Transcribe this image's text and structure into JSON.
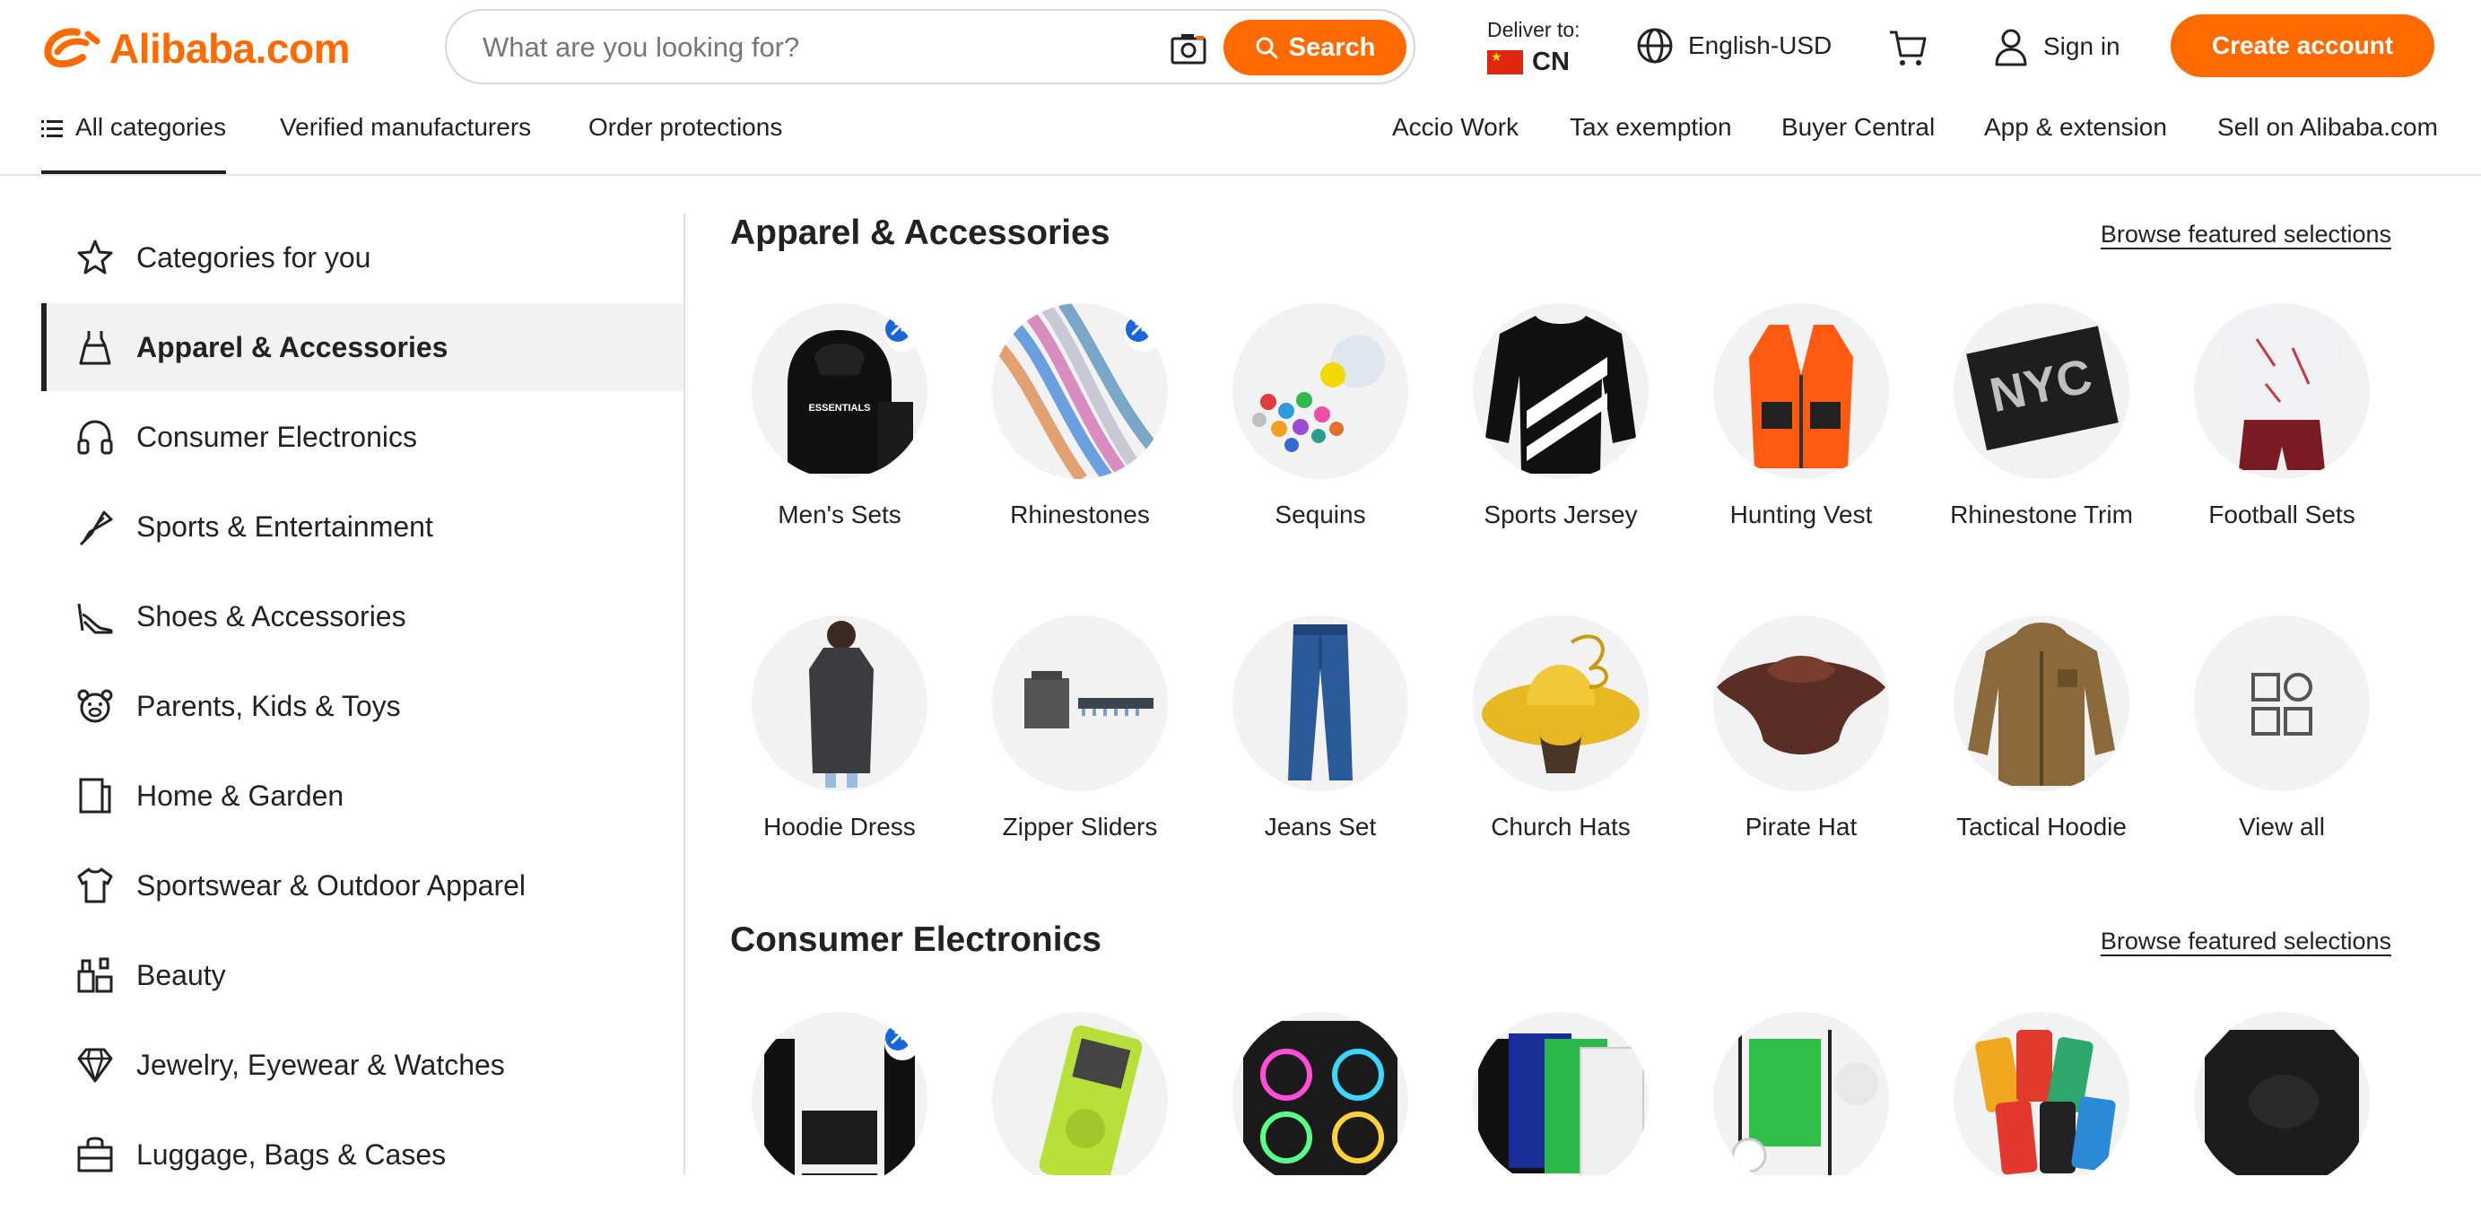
{
  "brand": {
    "name": "Alibaba.com",
    "accent": "#ff6a00"
  },
  "search": {
    "placeholder": "What are you looking for?",
    "button_label": "Search"
  },
  "deliver": {
    "label": "Deliver to:",
    "country": "CN"
  },
  "header": {
    "language": "English-USD",
    "signin": "Sign in",
    "create_account": "Create account"
  },
  "nav": {
    "left": [
      "All categories",
      "Verified manufacturers",
      "Order protections"
    ],
    "right": [
      "Accio Work",
      "Tax exemption",
      "Buyer Central",
      "App & extension",
      "Sell on Alibaba.com"
    ]
  },
  "sidebar": {
    "items": [
      {
        "label": "Categories for you",
        "icon": "star-icon"
      },
      {
        "label": "Apparel & Accessories",
        "icon": "dress-icon"
      },
      {
        "label": "Consumer Electronics",
        "icon": "headphones-icon"
      },
      {
        "label": "Sports & Entertainment",
        "icon": "badminton-icon"
      },
      {
        "label": "Shoes & Accessories",
        "icon": "high-heel-icon"
      },
      {
        "label": "Parents, Kids & Toys",
        "icon": "teddy-bear-icon"
      },
      {
        "label": "Home & Garden",
        "icon": "home-icon"
      },
      {
        "label": "Sportswear & Outdoor Apparel",
        "icon": "shirt-icon"
      },
      {
        "label": "Beauty",
        "icon": "cosmetics-icon"
      },
      {
        "label": "Jewelry, Eyewear & Watches",
        "icon": "diamond-icon"
      },
      {
        "label": "Luggage, Bags & Cases",
        "icon": "luggage-icon"
      }
    ],
    "active_index": 1
  },
  "sections": [
    {
      "title": "Apparel & Accessories",
      "browse": "Browse featured selections",
      "items": [
        "Men's Sets",
        "Rhinestones",
        "Sequins",
        "Sports Jersey",
        "Hunting Vest",
        "Rhinestone Trim",
        "Football Sets",
        "Hoodie Dress",
        "Zipper Sliders",
        "Jeans Set",
        "Church Hats",
        "Pirate Hat",
        "Tactical Hoodie",
        "View all"
      ]
    },
    {
      "title": "Consumer Electronics",
      "browse": "Browse featured selections"
    }
  ]
}
